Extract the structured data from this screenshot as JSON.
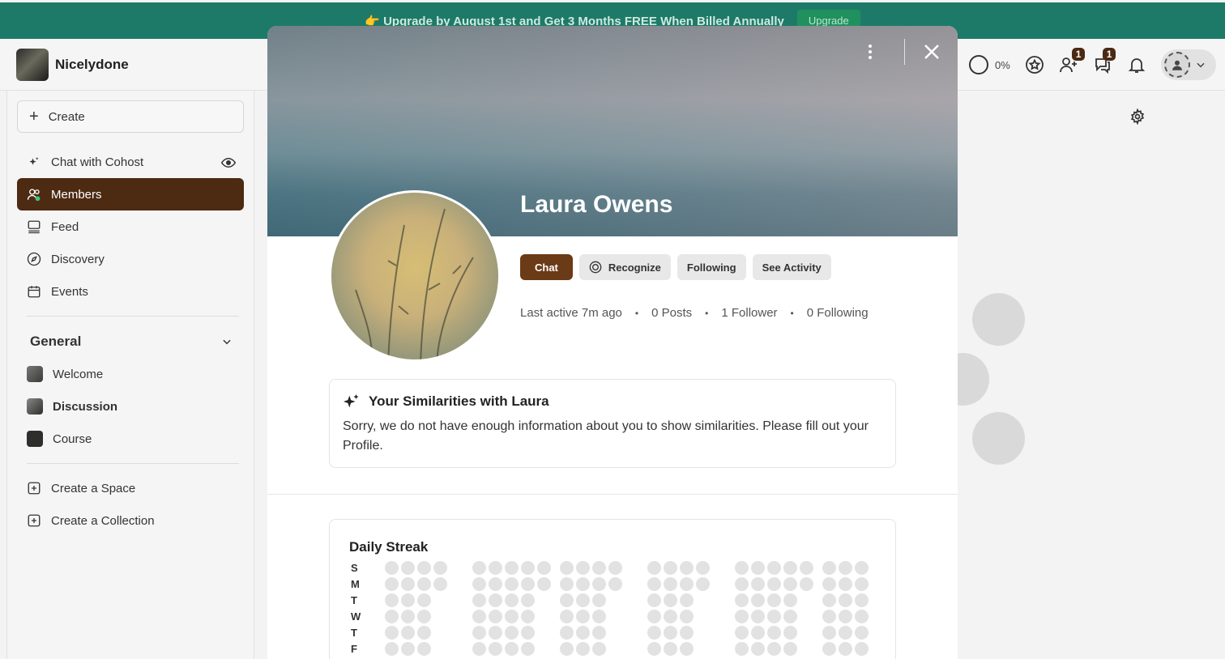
{
  "banner": {
    "text": "👉 Upgrade by August 1st and Get 3 Months FREE When Billed Annually",
    "button": "Upgrade"
  },
  "header": {
    "brand": "Nicelydone",
    "progress": "0%",
    "invites_badge": "1",
    "chat_badge": "1"
  },
  "sidebar": {
    "create": "Create",
    "items": [
      {
        "label": "Chat with Cohost",
        "icon": "sparkle-icon"
      },
      {
        "label": "Members",
        "icon": "members-icon"
      },
      {
        "label": "Feed",
        "icon": "feed-icon"
      },
      {
        "label": "Discovery",
        "icon": "compass-icon"
      },
      {
        "label": "Events",
        "icon": "calendar-icon"
      }
    ],
    "section": "General",
    "spaces": [
      {
        "label": "Welcome",
        "color": "#4a4a44"
      },
      {
        "label": "Discussion",
        "color": "#5a5a50"
      },
      {
        "label": "Course",
        "color": "#2e2e2c"
      }
    ],
    "create_space": "Create a Space",
    "create_collection": "Create a Collection"
  },
  "profile": {
    "name": "Laura Owens",
    "actions": {
      "chat": "Chat",
      "recognize": "Recognize",
      "following": "Following",
      "activity": "See Activity"
    },
    "stats": {
      "last_active": "Last active 7m ago",
      "posts": "0 Posts",
      "followers": "1 Follower",
      "following": "0 Following"
    },
    "similarities": {
      "title": "Your Similarities with Laura",
      "body": "Sorry, we do not have enough information about you to show similarities. Please fill out your Profile."
    },
    "streak": {
      "title": "Daily Streak",
      "days": [
        "S",
        "M",
        "T",
        "W",
        "T",
        "F"
      ]
    }
  },
  "colors": {
    "banner": "#1e7a68",
    "accent": "#4d2a12",
    "chat_button": "#6b3a17"
  }
}
